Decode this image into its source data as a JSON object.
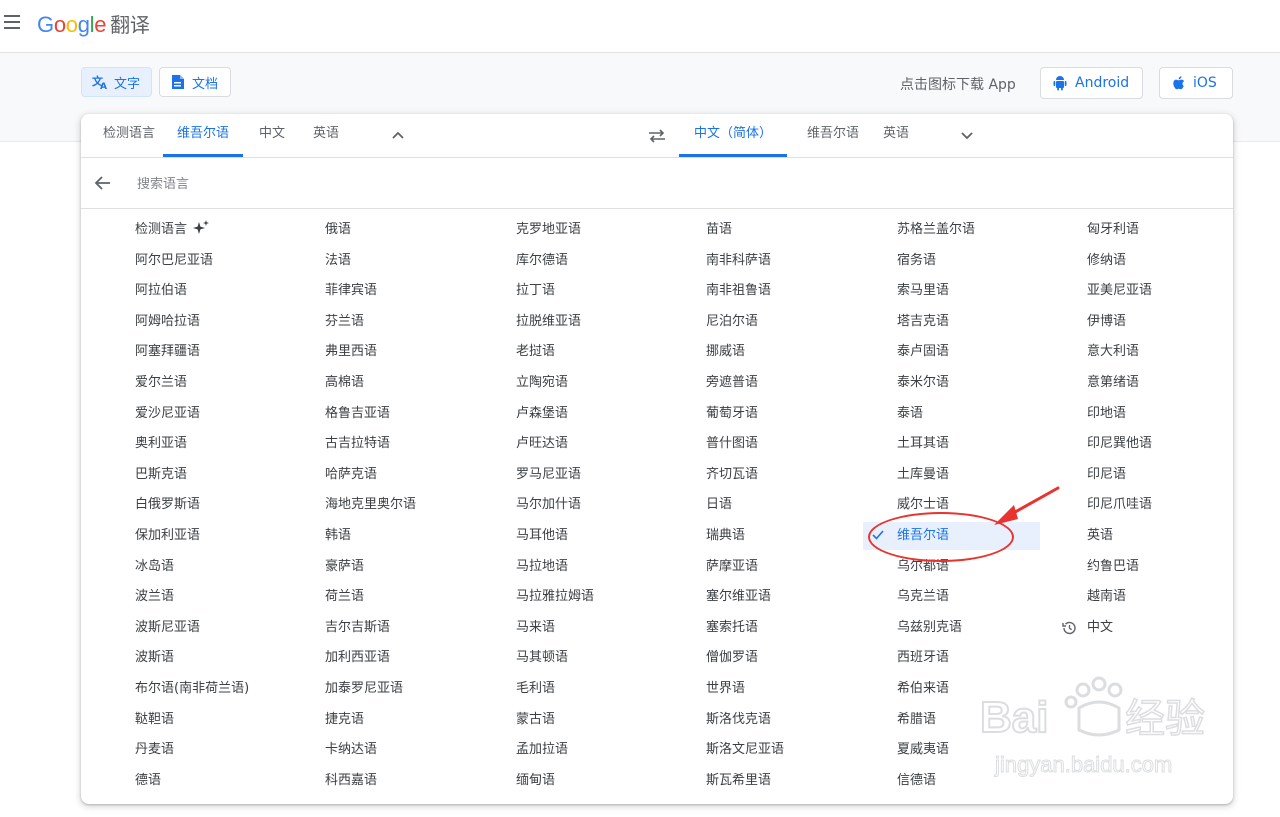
{
  "app": {
    "logo": {
      "g1": "G",
      "o1": "o",
      "o2": "o",
      "g2": "g",
      "l": "l",
      "e": "e",
      "product": "翻译"
    },
    "menu_icon": "hamburger-menu-icon"
  },
  "mode_tabs": [
    {
      "label": "文字",
      "icon": "translate-icon",
      "active": true
    },
    {
      "label": "文档",
      "icon": "document-icon",
      "active": false
    }
  ],
  "download": {
    "text": "点击图标下载 App",
    "android": {
      "label": "Android",
      "icon": "android-icon"
    },
    "ios": {
      "label": "iOS",
      "icon": "apple-icon"
    }
  },
  "source_langs": [
    "检测语言",
    "维吾尔语",
    "中文",
    "英语"
  ],
  "source_selected_index": 1,
  "target_langs": [
    "中文（简体）",
    "维吾尔语",
    "英语"
  ],
  "target_selected_index": 0,
  "search": {
    "placeholder": "搜索语言"
  },
  "columns": [
    [
      "检测语言",
      "阿尔巴尼亚语",
      "阿拉伯语",
      "阿姆哈拉语",
      "阿塞拜疆语",
      "爱尔兰语",
      "爱沙尼亚语",
      "奥利亚语",
      "巴斯克语",
      "白俄罗斯语",
      "保加利亚语",
      "冰岛语",
      "波兰语",
      "波斯尼亚语",
      "波斯语",
      "布尔语(南非荷兰语)",
      "鞑靼语",
      "丹麦语",
      "德语"
    ],
    [
      "俄语",
      "法语",
      "菲律宾语",
      "芬兰语",
      "弗里西语",
      "高棉语",
      "格鲁吉亚语",
      "古吉拉特语",
      "哈萨克语",
      "海地克里奥尔语",
      "韩语",
      "豪萨语",
      "荷兰语",
      "吉尔吉斯语",
      "加利西亚语",
      "加泰罗尼亚语",
      "捷克语",
      "卡纳达语",
      "科西嘉语"
    ],
    [
      "克罗地亚语",
      "库尔德语",
      "拉丁语",
      "拉脱维亚语",
      "老挝语",
      "立陶宛语",
      "卢森堡语",
      "卢旺达语",
      "罗马尼亚语",
      "马尔加什语",
      "马耳他语",
      "马拉地语",
      "马拉雅拉姆语",
      "马来语",
      "马其顿语",
      "毛利语",
      "蒙古语",
      "孟加拉语",
      "缅甸语"
    ],
    [
      "苗语",
      "南非科萨语",
      "南非祖鲁语",
      "尼泊尔语",
      "挪威语",
      "旁遮普语",
      "葡萄牙语",
      "普什图语",
      "齐切瓦语",
      "日语",
      "瑞典语",
      "萨摩亚语",
      "塞尔维亚语",
      "塞索托语",
      "僧伽罗语",
      "世界语",
      "斯洛伐克语",
      "斯洛文尼亚语",
      "斯瓦希里语"
    ],
    [
      "苏格兰盖尔语",
      "宿务语",
      "索马里语",
      "塔吉克语",
      "泰卢固语",
      "泰米尔语",
      "泰语",
      "土耳其语",
      "土库曼语",
      "威尔士语",
      "维吾尔语",
      "乌尔都语",
      "乌克兰语",
      "乌兹别克语",
      "西班牙语",
      "希伯来语",
      "希腊语",
      "夏威夷语",
      "信德语"
    ],
    [
      "匈牙利语",
      "修纳语",
      "亚美尼亚语",
      "伊博语",
      "意大利语",
      "意第绪语",
      "印地语",
      "印尼巽他语",
      "印尼语",
      "印尼爪哇语",
      "英语",
      "约鲁巴语",
      "越南语",
      "中文"
    ]
  ],
  "selected_language": "维吾尔语",
  "recent_language": "中文",
  "icons": {
    "detect_sparkle": "sparkle-icon",
    "check": "checkmark-icon",
    "history": "history-icon",
    "swap": "swap-icon",
    "back": "back-arrow-icon",
    "chevron_up": "chevron-up-icon",
    "chevron_down": "chevron-down-icon"
  },
  "colors": {
    "accent": "#1a73e8",
    "selected_bg": "#e8f0fe",
    "annotation": "#e8332f"
  },
  "watermark": {
    "brand": "Bai",
    "brand_cn": "经验",
    "url": "jingyan.baidu.com"
  }
}
